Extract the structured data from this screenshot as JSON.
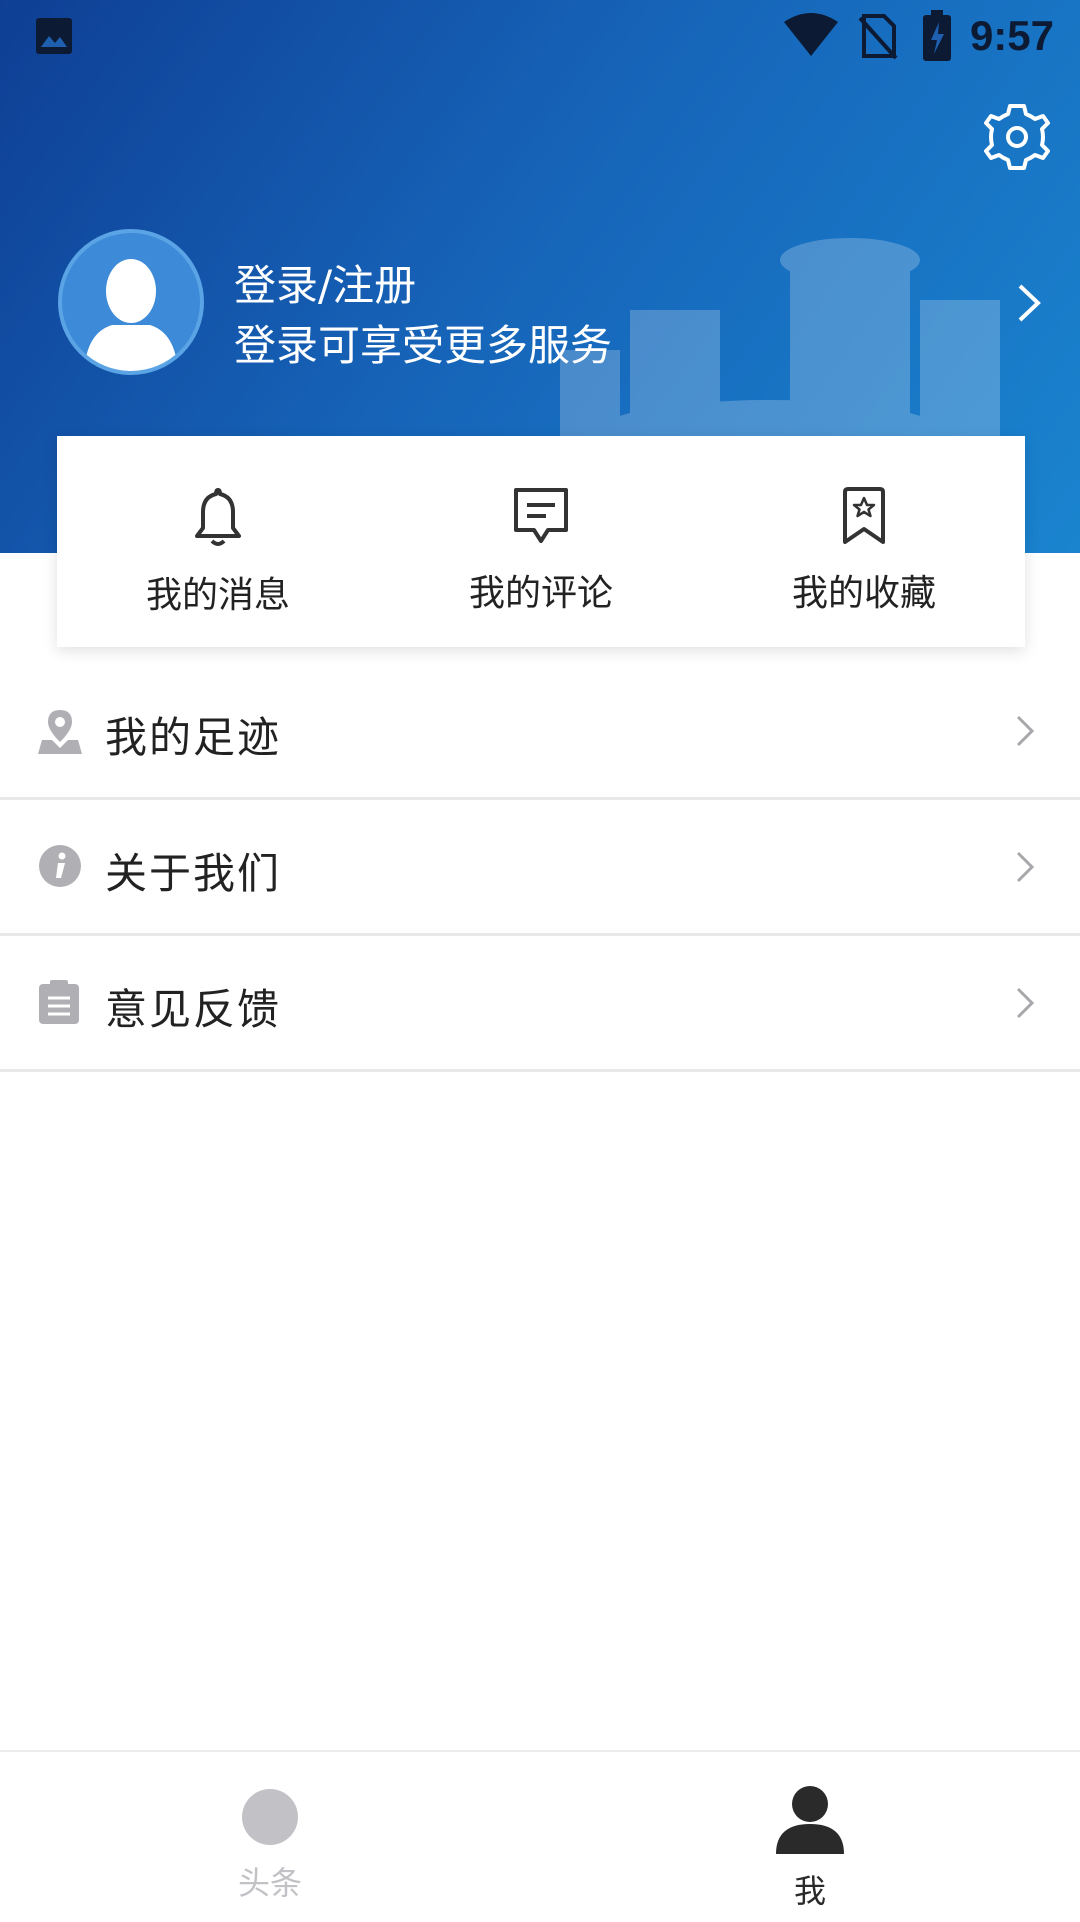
{
  "status_bar": {
    "time": "9:57"
  },
  "profile": {
    "title": "登录/注册",
    "subtitle": "登录可享受更多服务"
  },
  "quick_actions": [
    {
      "label": "我的消息",
      "icon": "bell-icon"
    },
    {
      "label": "我的评论",
      "icon": "comment-icon"
    },
    {
      "label": "我的收藏",
      "icon": "bookmark-icon"
    }
  ],
  "menu_items": [
    {
      "label": "我的足迹",
      "icon": "location-pin-icon"
    },
    {
      "label": "关于我们",
      "icon": "info-icon"
    },
    {
      "label": "意见反馈",
      "icon": "clipboard-icon"
    }
  ],
  "bottom_nav": [
    {
      "label": "头条",
      "icon": "circle-icon",
      "active": false
    },
    {
      "label": "我",
      "icon": "person-icon",
      "active": true
    }
  ],
  "colors": {
    "header_start": "#0e3f94",
    "header_end": "#1a84cf",
    "text_dark": "#222222",
    "icon_gray": "#b0b0b4",
    "nav_active": "#2a2a2a",
    "nav_inactive": "#c2c2c6"
  }
}
